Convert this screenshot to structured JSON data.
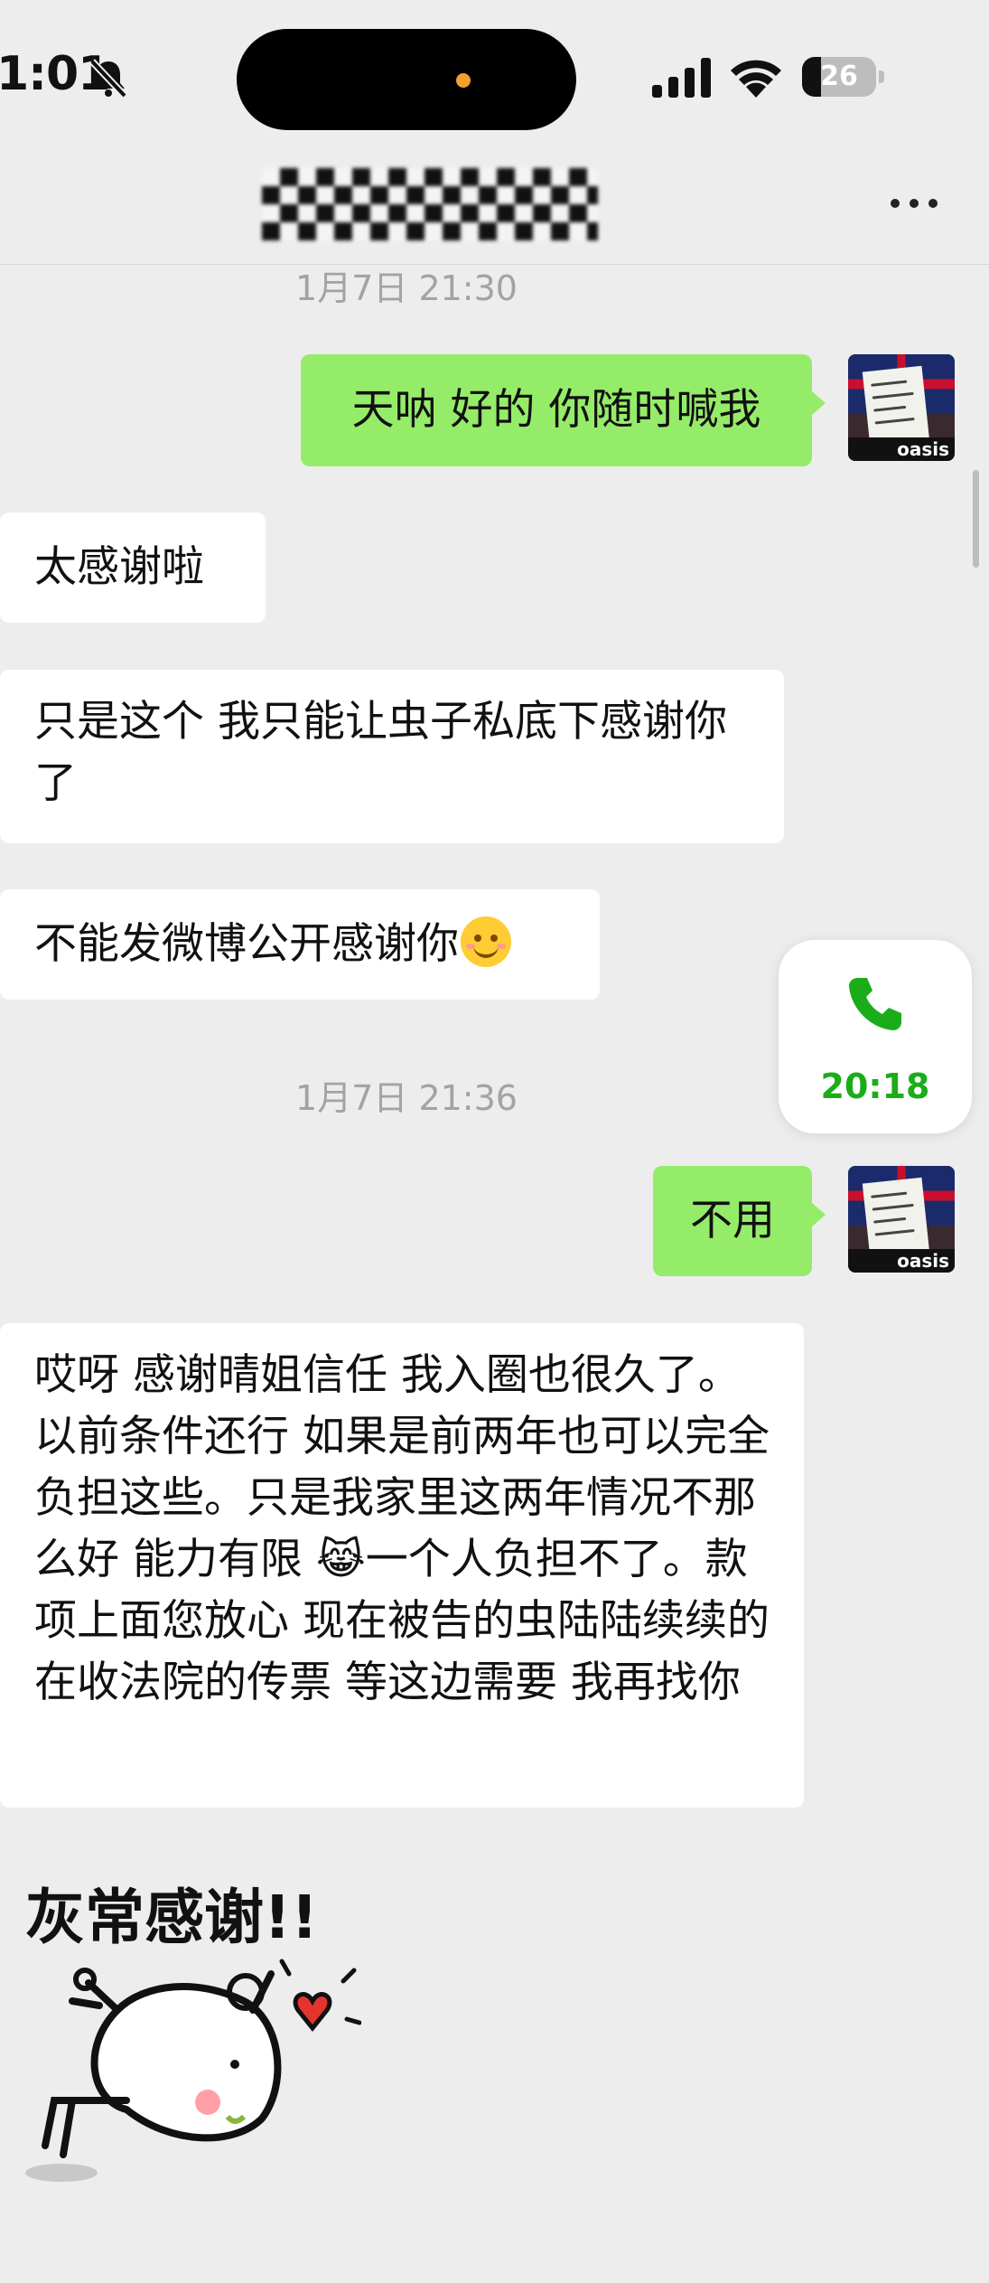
{
  "status_bar": {
    "time": "1:01",
    "battery_level": "26"
  },
  "chat": {
    "messages": [
      {
        "type": "timestamp",
        "text": "1月7日 21:30"
      },
      {
        "type": "outgoing",
        "text": "天呐 好的 你随时喊我"
      },
      {
        "type": "incoming",
        "text": "太感谢啦"
      },
      {
        "type": "incoming",
        "text": "只是这个 我只能让虫子私底下感谢你了"
      },
      {
        "type": "incoming",
        "text": "不能发微博公开感谢你",
        "emoji": "smiling-face"
      },
      {
        "type": "timestamp",
        "text": "1月7日 21:36"
      },
      {
        "type": "outgoing",
        "text": "不用"
      },
      {
        "type": "incoming",
        "text": "哎呀 感谢晴姐信任 我入圈也很久了。以前条件还行 如果是前两年也可以完全负担这些。只是我家里这两年情况不那么好 能力有限 😹一个人负担不了。款项上面您放心 现在被告的虫陆陆续续的在收法院的传票  等这边需要 我再找你",
        "emoji": "face-with-tears-of-joy"
      },
      {
        "type": "sticker",
        "text": "灰常感谢!!"
      }
    ],
    "call_card": {
      "duration": "20:18"
    },
    "avatar_text": "oasis"
  },
  "colors": {
    "background": "#ededed",
    "outgoing_bubble": "#95ec69",
    "incoming_bubble": "#ffffff",
    "call_green": "#1aad19"
  }
}
